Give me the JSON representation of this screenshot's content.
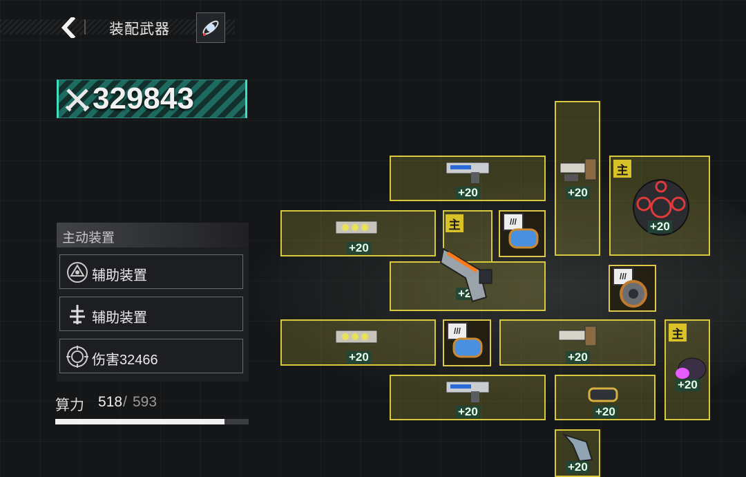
{
  "header": {
    "title": "装配武器"
  },
  "power": {
    "value": "329843"
  },
  "active_panel": {
    "title": "主动装置",
    "items": [
      {
        "label": "辅助装置"
      },
      {
        "label": "辅助装置"
      },
      {
        "label": "伤害32466"
      }
    ]
  },
  "compute": {
    "label": "算力",
    "used": "518",
    "slash": "/",
    "total": "593",
    "fraction": 0.8735
  },
  "slots": {
    "level_text": "+20",
    "main_badge": "主"
  },
  "colors": {
    "slot_border": "#d9c93f",
    "accent_teal": "#3ee0c4",
    "main_badge": "#d8c227"
  }
}
